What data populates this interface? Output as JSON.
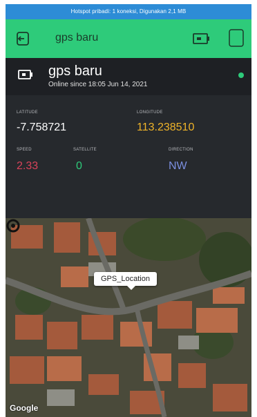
{
  "statusbar": {
    "text": "Hotspot pribadi: 1 koneksi, Digunakan 2,1 MB"
  },
  "appbar": {
    "title": "gps baru"
  },
  "device": {
    "name": "gps baru",
    "status": "Online since 18:05 Jun 14, 2021",
    "status_color": "#2ecb7a"
  },
  "widgets": {
    "latitude": {
      "label": "LATITUDE",
      "value": "-7.758721",
      "color": "#ffffff"
    },
    "longitude": {
      "label": "LONGITUDE",
      "value": "113.238510",
      "color": "#f0b429"
    },
    "speed": {
      "label": "SPEED",
      "value": "2.33",
      "color": "#d9435a"
    },
    "satellite": {
      "label": "SATELLITE",
      "value": "0",
      "color": "#2ecb7a"
    },
    "direction": {
      "label": "DIRECTION",
      "value": "NW",
      "color": "#7b8fe0"
    }
  },
  "map": {
    "marker_label": "GPS_Location",
    "attribution": "Google"
  },
  "colors": {
    "header_green": "#2ecb7a",
    "status_blue": "#2d8cd6",
    "panel_bg": "#26292d"
  }
}
